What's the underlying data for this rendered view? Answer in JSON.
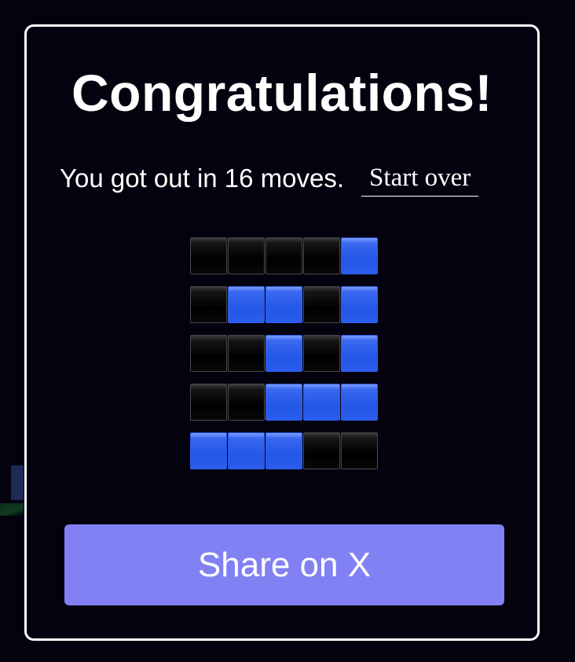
{
  "modal": {
    "title": "Congratulations!",
    "result_text": "You got out in 16 moves.",
    "start_over_label": "Start over",
    "share_label": "Share on X"
  },
  "colors": {
    "background": "#04020f",
    "border": "#ffffff",
    "text": "#ffffff",
    "tile_black": "#000000",
    "tile_blue": "#2457e6",
    "share_button": "#8181f4"
  },
  "result_grid": [
    [
      "black",
      "black",
      "black",
      "black",
      "blue"
    ],
    [
      "black",
      "blue",
      "blue",
      "black",
      "blue"
    ],
    [
      "black",
      "black",
      "blue",
      "black",
      "blue"
    ],
    [
      "black",
      "black",
      "blue",
      "blue",
      "blue"
    ],
    [
      "blue",
      "blue",
      "blue",
      "black",
      "black"
    ]
  ]
}
